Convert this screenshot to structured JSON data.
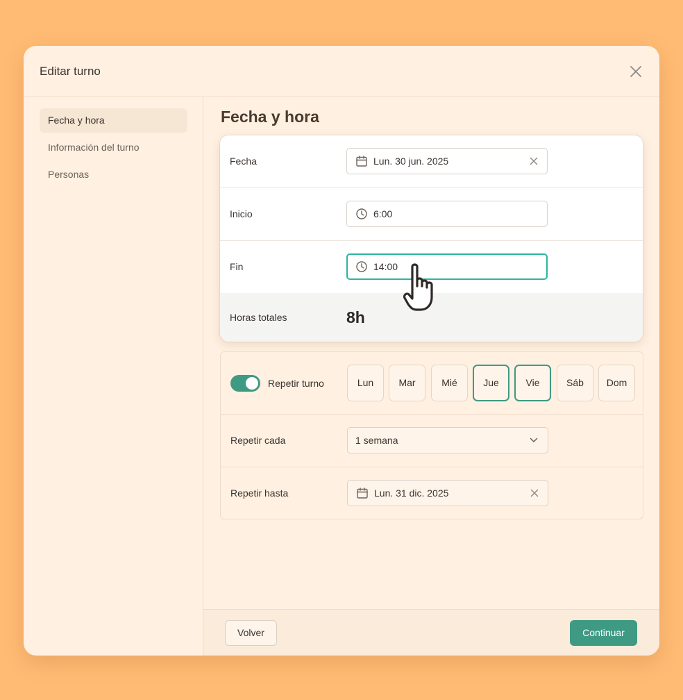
{
  "modal": {
    "title": "Editar turno"
  },
  "sidebar": {
    "items": [
      {
        "label": "Fecha y hora",
        "active": true
      },
      {
        "label": "Información del turno",
        "active": false
      },
      {
        "label": "Personas",
        "active": false
      }
    ]
  },
  "section": {
    "title": "Fecha y hora"
  },
  "form": {
    "fecha": {
      "label": "Fecha",
      "value": "Lun. 30 jun. 2025",
      "icon": "calendar-icon"
    },
    "inicio": {
      "label": "Inicio",
      "value": "6:00",
      "icon": "clock-icon"
    },
    "fin": {
      "label": "Fin",
      "value": "14:00",
      "icon": "clock-icon",
      "focused": true
    },
    "total": {
      "label": "Horas totales",
      "value": "8h"
    }
  },
  "repeat": {
    "toggle_label": "Repetir turno",
    "enabled": true,
    "days": [
      {
        "label": "Lun",
        "selected": false
      },
      {
        "label": "Mar",
        "selected": false
      },
      {
        "label": "Mié",
        "selected": false
      },
      {
        "label": "Jue",
        "selected": true
      },
      {
        "label": "Vie",
        "selected": true
      },
      {
        "label": "Sáb",
        "selected": false
      },
      {
        "label": "Dom",
        "selected": false
      }
    ],
    "cada": {
      "label": "Repetir cada",
      "value": "1 semana"
    },
    "hasta": {
      "label": "Repetir hasta",
      "value": "Lun. 31 dic. 2025"
    }
  },
  "footer": {
    "back_label": "Volver",
    "next_label": "Continuar"
  },
  "colors": {
    "background": "#FFBB74",
    "modal": "#FFF0E1",
    "accent": "#3E9A83",
    "focus": "#2BB5A0"
  }
}
